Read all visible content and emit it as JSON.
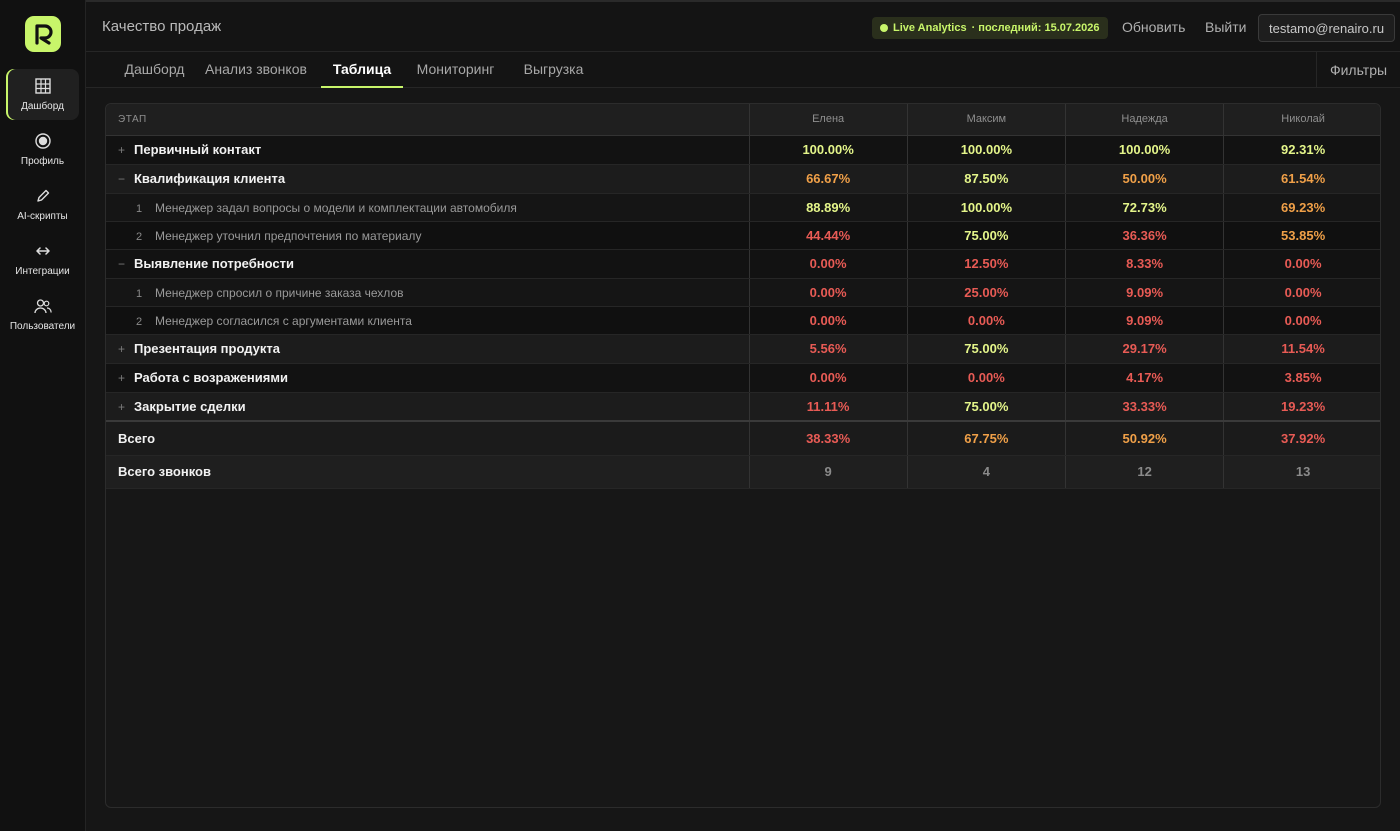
{
  "app": {
    "page_title": "Качество продаж"
  },
  "sidebar": {
    "items": [
      {
        "label": "Дашборд",
        "icon": "grid-icon",
        "active": true
      },
      {
        "label": "Профиль",
        "icon": "profile-circle-icon",
        "active": false
      },
      {
        "label": "AI-скрипты",
        "icon": "pencil-icon",
        "active": false
      },
      {
        "label": "Интеграции",
        "icon": "arrows-icon",
        "active": false
      },
      {
        "label": "Пользователи",
        "icon": "users-icon",
        "active": false
      }
    ]
  },
  "header": {
    "live_label": "Live Analytics",
    "live_last": "· последний: 15.07.2026",
    "refresh": "Обновить",
    "logout": "Выйти",
    "email": "testamo@renairo.ru"
  },
  "tabs": [
    {
      "label": "Дашборд",
      "active": false
    },
    {
      "label": "Анализ звонков",
      "active": false
    },
    {
      "label": "Таблица",
      "active": true
    },
    {
      "label": "Мониторинг",
      "active": false
    },
    {
      "label": "Выгрузка",
      "active": false
    }
  ],
  "filters_label": "Фильтры",
  "table": {
    "stage_header": "ЭТАП",
    "people": [
      "Елена",
      "Максим",
      "Надежда",
      "Николай"
    ],
    "rows": [
      {
        "type": "group",
        "toggle": "+",
        "name": "Первичный контакт",
        "values": [
          "100.00%",
          "100.00%",
          "100.00%",
          "92.31%"
        ],
        "colors": [
          "g",
          "g",
          "g",
          "g"
        ]
      },
      {
        "type": "group",
        "toggle": "−",
        "name": "Квалификация клиента",
        "values": [
          "66.67%",
          "87.50%",
          "50.00%",
          "61.54%"
        ],
        "colors": [
          "o",
          "g",
          "o",
          "o"
        ]
      },
      {
        "type": "sub",
        "num": "1",
        "name": "Менеджер задал вопросы о модели и комплектации автомобиля",
        "values": [
          "88.89%",
          "100.00%",
          "72.73%",
          "69.23%"
        ],
        "colors": [
          "g",
          "g",
          "g",
          "o"
        ]
      },
      {
        "type": "sub",
        "num": "2",
        "name": "Менеджер уточнил предпочтения по материалу",
        "values": [
          "44.44%",
          "75.00%",
          "36.36%",
          "53.85%"
        ],
        "colors": [
          "r",
          "g",
          "r",
          "o"
        ]
      },
      {
        "type": "group",
        "toggle": "−",
        "name": "Выявление потребности",
        "values": [
          "0.00%",
          "12.50%",
          "8.33%",
          "0.00%"
        ],
        "colors": [
          "r",
          "r",
          "r",
          "r"
        ]
      },
      {
        "type": "sub",
        "num": "1",
        "name": "Менеджер спросил о причине заказа чехлов",
        "values": [
          "0.00%",
          "25.00%",
          "9.09%",
          "0.00%"
        ],
        "colors": [
          "r",
          "r",
          "r",
          "r"
        ]
      },
      {
        "type": "sub",
        "num": "2",
        "name": "Менеджер согласился с аргументами клиента",
        "values": [
          "0.00%",
          "0.00%",
          "9.09%",
          "0.00%"
        ],
        "colors": [
          "r",
          "r",
          "r",
          "r"
        ]
      },
      {
        "type": "group",
        "toggle": "+",
        "name": "Презентация продукта",
        "values": [
          "5.56%",
          "75.00%",
          "29.17%",
          "11.54%"
        ],
        "colors": [
          "r",
          "g",
          "r",
          "r"
        ]
      },
      {
        "type": "group",
        "toggle": "+",
        "name": "Работа с возражениями",
        "values": [
          "0.00%",
          "0.00%",
          "4.17%",
          "3.85%"
        ],
        "colors": [
          "r",
          "r",
          "r",
          "r"
        ]
      },
      {
        "type": "group",
        "toggle": "+",
        "name": "Закрытие сделки",
        "values": [
          "11.11%",
          "75.00%",
          "33.33%",
          "19.23%"
        ],
        "colors": [
          "r",
          "g",
          "r",
          "r"
        ]
      }
    ],
    "total": {
      "label": "Всего",
      "values": [
        "38.33%",
        "67.75%",
        "50.92%",
        "37.92%"
      ],
      "colors": [
        "r",
        "o",
        "o",
        "r"
      ]
    },
    "calls": {
      "label": "Всего звонков",
      "values": [
        "9",
        "4",
        "12",
        "13"
      ]
    }
  },
  "colors": {
    "accent": "#c8f56a",
    "good": "#e4f58a",
    "mid": "#f0a048",
    "bad": "#e85b55"
  }
}
